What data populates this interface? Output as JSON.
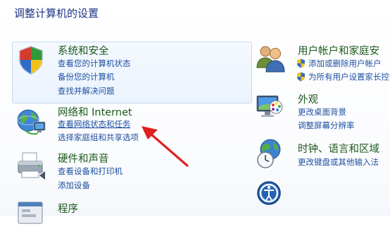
{
  "page": {
    "title": "调整计算机的设置"
  },
  "categories": {
    "system_security": {
      "title": "系统和安全",
      "links": [
        "查看您的计算机状态",
        "备份您的计算机",
        "查找并解决问题"
      ]
    },
    "network": {
      "title": "网络和 Internet",
      "links": [
        "查看网络状态和任务",
        "选择家庭组和共享选项"
      ]
    },
    "hardware": {
      "title": "硬件和声音",
      "links": [
        "查看设备和打印机",
        "添加设备"
      ]
    },
    "programs": {
      "title": "程序"
    },
    "user_accounts": {
      "title": "用户帐户和家庭安",
      "links": [
        "添加或删除用户帐户",
        "为所有用户设置家长控"
      ]
    },
    "appearance": {
      "title": "外观",
      "links": [
        "更改桌面背景",
        "调整屏幕分辨率"
      ]
    },
    "clock_region": {
      "title": "时钟、语言和区域",
      "links": [
        "更改键盘或其他输入法"
      ]
    }
  },
  "colors": {
    "category_title": "#1c5a1c",
    "link": "#1e50a2",
    "page_title": "#1e3287",
    "selection_border": "#c6dcf3",
    "annotation_arrow": "#e02020"
  },
  "icons": {
    "system_security": "security-shield-icon",
    "network": "network-globe-icon",
    "hardware": "printer-icon",
    "programs": "programs-icon",
    "user_accounts": "users-icon",
    "appearance": "monitor-icon",
    "clock_region": "globe-clock-icon",
    "ease_of_access": "ease-of-access-icon"
  }
}
